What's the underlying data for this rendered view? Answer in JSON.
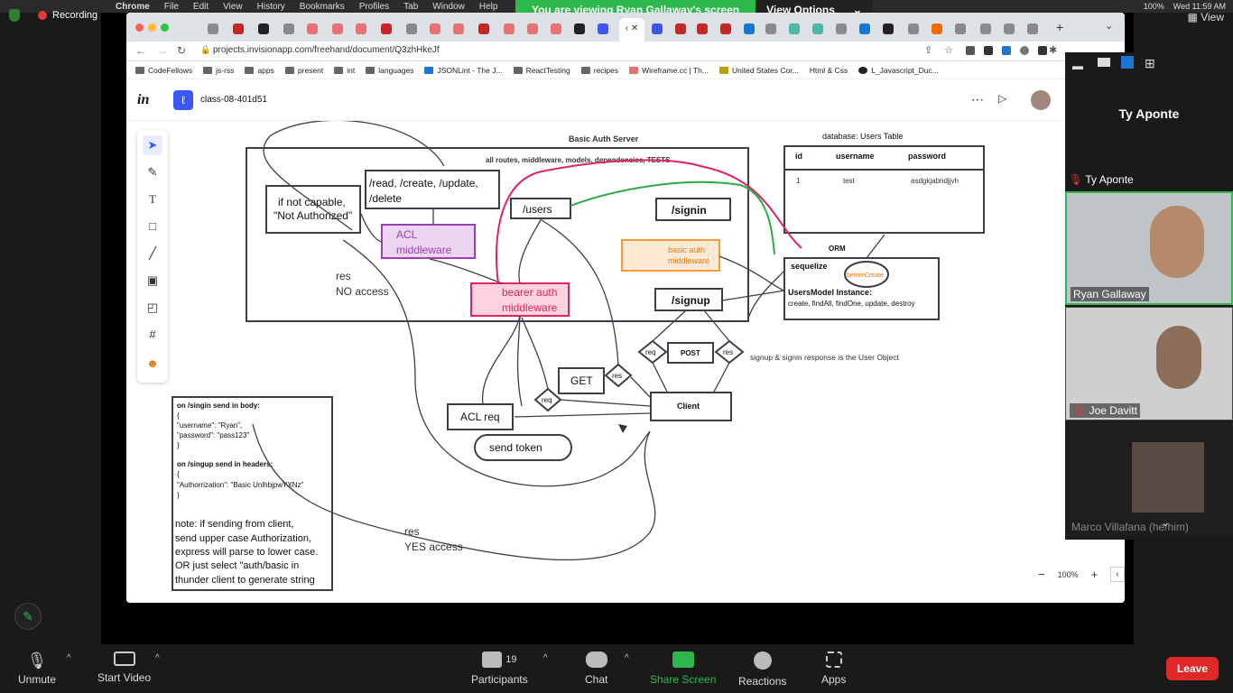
{
  "mac_menu": {
    "items": [
      "Chrome",
      "File",
      "Edit",
      "View",
      "History",
      "Bookmarks",
      "Profiles",
      "Tab",
      "Window",
      "Help"
    ],
    "battery": "100%",
    "clock": "Wed 11:59 AM"
  },
  "zoom": {
    "recording": "Recording",
    "share_banner": "You are viewing Ryan Gallaway's screen",
    "view_options": "View Options",
    "view": "View",
    "bottom": {
      "unmute": "Unmute",
      "start_video": "Start Video",
      "participants": "Participants",
      "participants_count": "19",
      "chat": "Chat",
      "share_screen": "Share Screen",
      "reactions": "Reactions",
      "apps": "Apps",
      "leave": "Leave"
    },
    "speaker_name": "Ty Aponte",
    "tiles": [
      {
        "name": "Ty Aponte"
      },
      {
        "name": "Ryan Gallaway"
      },
      {
        "name": "Joe Davitt"
      },
      {
        "name": "Marco Villafana (he/him)"
      }
    ]
  },
  "browser": {
    "url": "projects.invisionapp.com/freehand/document/Q3zhHkeJf",
    "bookmarks": [
      "CodeFellows",
      "js-rss",
      "apps",
      "present",
      "int",
      "languages",
      "JSONLint - The J...",
      "ReactTesting",
      "recipes",
      "Wireframe.cc | Th...",
      "United States Cor...",
      "Html & Css",
      "L_Javascript_Duc..."
    ]
  },
  "invision": {
    "logo": "in",
    "doc_name": "class-08-401d51",
    "zoom_level": "100%"
  },
  "diagram": {
    "server_title": "Basic Auth Server",
    "server_subtitle": "all routes, middleware, models, dependencies,  TESTS",
    "not_capable": "if not capable, \"Not Authorized\"",
    "routes": "/read, /create, /update, /delete",
    "acl_mw": "ACL middleware",
    "users": "/users",
    "signin": "/signin",
    "signup": "/signup",
    "basic_auth_mw": "basic auth middleware",
    "bearer_mw": "bearer auth middleware",
    "res_no": "res",
    "no_access": "NO access",
    "res_yes": "res",
    "yes_access": "YES access",
    "db_title": "database:  Users Table",
    "db_cols": [
      "id",
      "username",
      "password"
    ],
    "db_row": [
      "1",
      "test",
      "asdgkjabndjjvh"
    ],
    "orm": "ORM",
    "sequelize": "sequelize",
    "before_create": "beforeCreate",
    "model_instance": "UsersModel Instance:",
    "model_methods": "create, findAll, findOne, update, destroy",
    "req": "req",
    "post": "POST",
    "res": "res",
    "signup_note": "signup & signin response is the User Object",
    "get": "GET",
    "client": "Client",
    "acl_req": "ACL req",
    "send_token": "send token",
    "note_lines": [
      "on /singin send in body:",
      "{",
      "   \"username\": \"Ryan\",",
      "   \"password\": \"pass123\"",
      "}",
      "on /singup send in headers:",
      "{",
      "   \"Authorrization\": \"Basic UnlhbjpwYXNz\"",
      "}"
    ],
    "note_para": [
      "note:  if sending from client,",
      "send upper case Authorization,",
      "express will parse to lower case.",
      "OR just select \"auth/basic in",
      "thunder client to generate string"
    ]
  }
}
